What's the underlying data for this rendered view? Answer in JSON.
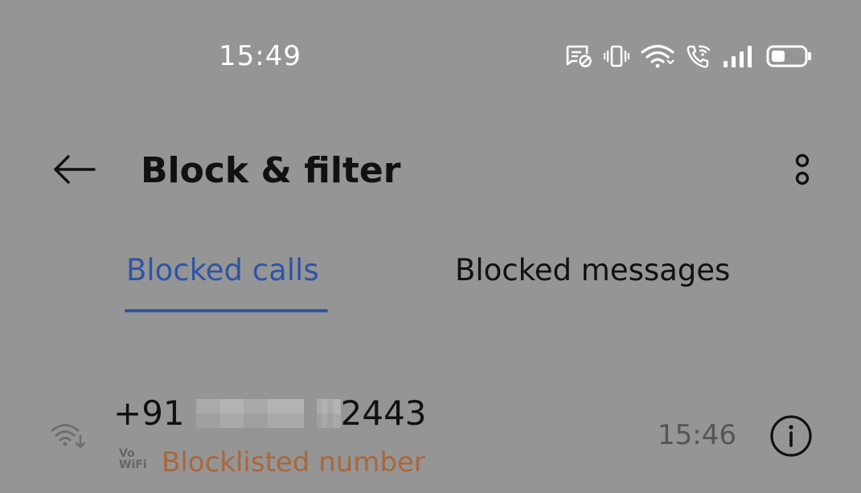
{
  "status_bar": {
    "time": "15:49",
    "icons": [
      "blocked-message-notification-icon",
      "vibrate-icon",
      "wifi-icon",
      "wifi-calling-icon",
      "signal-icon",
      "battery-icon"
    ]
  },
  "app_bar": {
    "title": "Block & filter",
    "back_icon": "arrow-left-icon",
    "more_icon": "more-vertical-icon"
  },
  "tabs": [
    {
      "label": "Blocked calls",
      "active": true
    },
    {
      "label": "Blocked messages",
      "active": false
    }
  ],
  "blocked_calls": [
    {
      "number_prefix": "+91",
      "number_suffix": "2443",
      "badge": "Vo WiFi",
      "reason": "Blocklisted number",
      "time": "15:46",
      "type_icon": "wifi-call-incoming-icon",
      "info_icon": "info-icon"
    }
  ],
  "colors": {
    "background": "#959595",
    "accent": "#2f55a4",
    "reason_text": "#a8683c",
    "primary_text": "#111111",
    "status_text": "#ffffff"
  }
}
